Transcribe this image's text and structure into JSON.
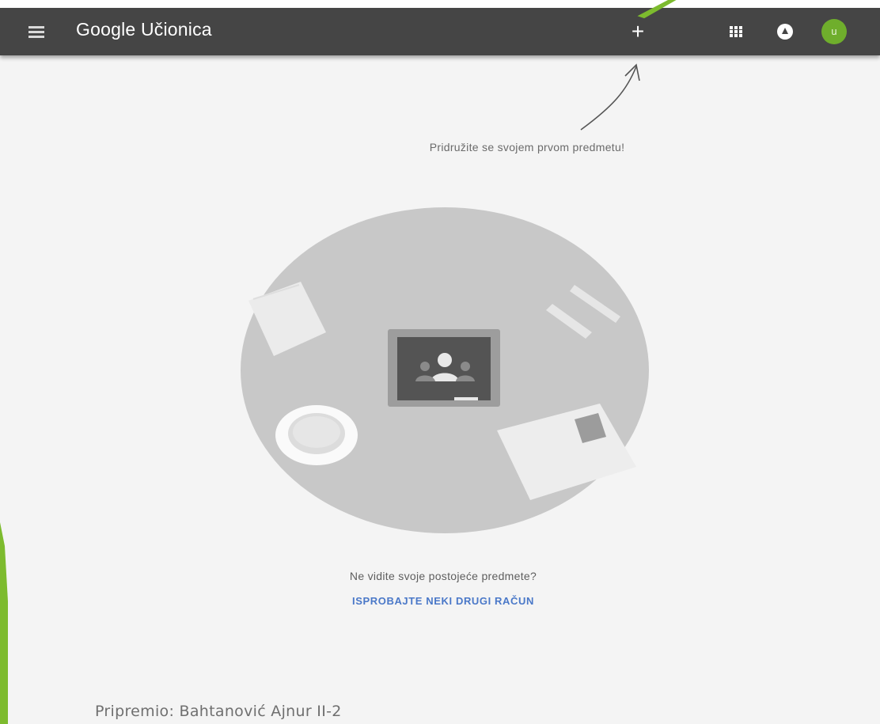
{
  "header": {
    "app_title": "Google Učionica",
    "add_label": "+",
    "avatar_initial": "u",
    "avatar_color": "#6fae2c",
    "bar_color": "#454545"
  },
  "icons": {
    "menu": "menu-icon",
    "add": "plus-icon",
    "apps": "apps-grid-icon",
    "notifications": "notification-icon",
    "hint_arrow": "arrow-icon"
  },
  "main": {
    "hint": "Pridružite se svojem prvom predmetu!",
    "question": "Ne vidite svoje postojeće predmete?",
    "switch_account_label": "ISPROBAJTE NEKI DRUGI RAČUN",
    "link_color": "#4a78c8"
  },
  "footer": {
    "credit": "Pripremio: Bahtanović Ajnur II-2"
  },
  "decoration": {
    "accent_color": "#7dbb2e"
  }
}
